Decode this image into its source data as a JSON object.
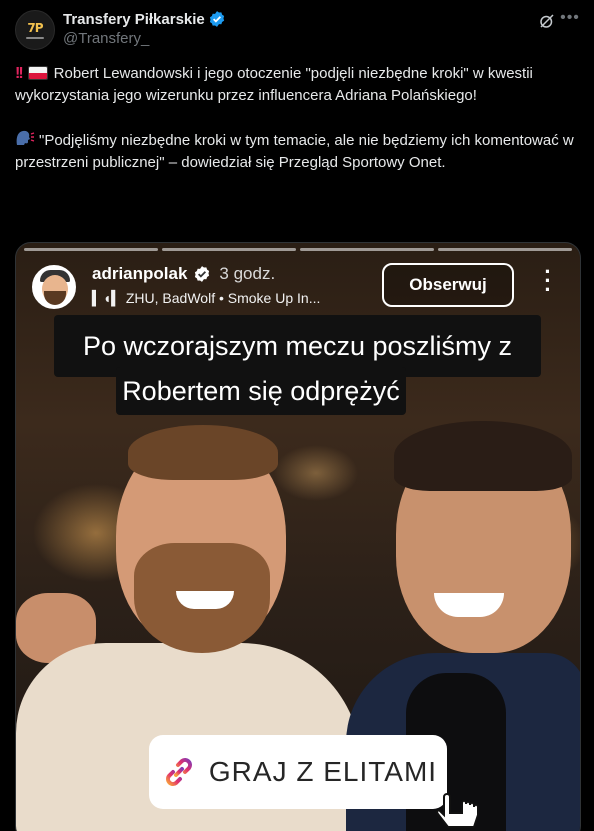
{
  "tweet": {
    "display_name": "Transfery Piłkarskie",
    "handle": "@Transfery_",
    "avatar_logo_text": "7P",
    "paragraph1": "Robert Lewandowski i jego otoczenie \"podjęli niezbędne kroki\" w kwestii wykorzystania jego wizerunku przez influencera Adriana Polańskiego!",
    "paragraph2": "\"Podjęliśmy niezbędne kroki w tym temacie, ale nie będziemy ich komentować w przestrzeni publicznej\" – dowiedział się Przegląd Sportowy Onet.",
    "icons": [
      "verified-badge-icon",
      "grok-icon",
      "more-icon",
      "double-exclamation-icon",
      "poland-flag-icon",
      "speaking-head-icon"
    ]
  },
  "media": {
    "story_username": "adrianpolak",
    "story_time": "3 godz.",
    "story_music": "▍◖▍ ZHU, BadWolf • Smoke Up In...",
    "follow_label": "Obserwuj",
    "caption_line1": "Po wczorajszym meczu poszliśmy z",
    "caption_line2": "Robertem się odprężyć",
    "cta_label": "GRAJ Z ELITAMI",
    "progress_segments": 4
  },
  "colors": {
    "background": "#000000",
    "text": "#e7e9ea",
    "muted": "#71767b",
    "verified_blue": "#1d9bf0",
    "alert_red": "#e0245e"
  }
}
